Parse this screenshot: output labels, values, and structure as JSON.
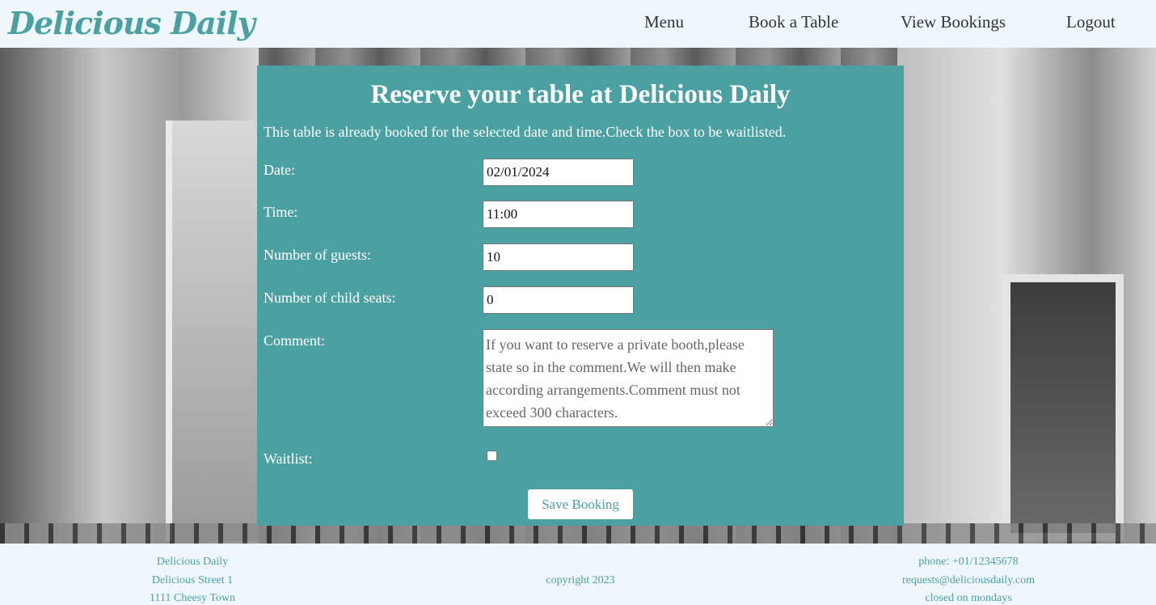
{
  "header": {
    "brand": "Delicious Daily",
    "nav": [
      "Menu",
      "Book a Table",
      "View Bookings",
      "Logout"
    ]
  },
  "form": {
    "title": "Reserve your table at Delicious Daily",
    "notice": "This table is already booked for the selected date and time.Check the box to be waitlisted.",
    "date": {
      "label": "Date:",
      "value": "02/01/2024"
    },
    "time": {
      "label": "Time:",
      "value": "11:00"
    },
    "guests": {
      "label": "Number of guests:",
      "value": "10"
    },
    "child_seats": {
      "label": "Number of child seats:",
      "value": "0"
    },
    "comment": {
      "label": "Comment:",
      "placeholder": "If you want to reserve a private booth,please state so in the comment.We will then make according arrangements.Comment must not exceed 300 characters."
    },
    "waitlist": {
      "label": "Waitlist:",
      "checked": false
    },
    "save_label": "Save Booking"
  },
  "footer": {
    "address": [
      "Delicious Daily",
      "Delicious Street 1",
      "1111 Cheesy Town"
    ],
    "copyright": "copyright 2023",
    "contact": [
      "phone: +01/12345678",
      "requests@deliciousdaily.com",
      "closed on mondays"
    ]
  },
  "colors": {
    "accent": "#4ba0a2",
    "header_bg": "#f0f7fc"
  }
}
